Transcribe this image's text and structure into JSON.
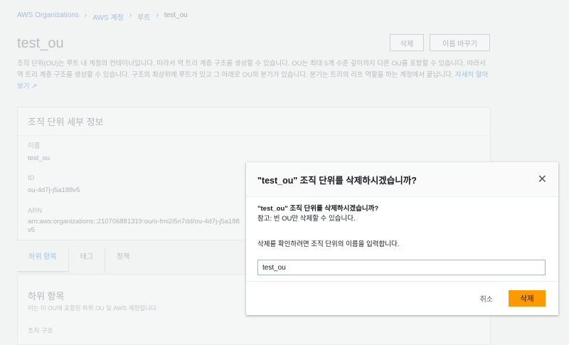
{
  "breadcrumb": [
    "AWS Organizations",
    "AWS 계정",
    "루트",
    "test_ou"
  ],
  "page": {
    "title": "test_ou",
    "delete_label": "삭제",
    "rename_label": "이름 바꾸기",
    "description": "조직 단위(OU)는 루트 내 계정의 컨테이너입니다. 따라서 역 트리 계층 구조를 생성할 수 있습니다. OU는 최대 5개 수준 깊이까지 다른 OU를 포함할 수 있습니다. 따라서 역 트리 계층 구조를 생성할 수 있습니다. 구조의 최상위에 루트가 있고 그 아래로 OU의 분기가 있습니다. 분기는 트리의 리프 역할을 하는 계정에서 끝납니다.",
    "learn_more": "자세히 알아보기"
  },
  "details": {
    "title": "조직 단위 세부 정보",
    "name_label": "이름",
    "name": "test_ou",
    "id_label": "ID",
    "id": "ou-4d7j-j5a188v5",
    "arn_label": "ARN",
    "arn": "arn:aws:organizations::210706881319:ou/o-fmi2i5n7dd/ou-4d7j-j5a188v5"
  },
  "tabs": [
    "하위 항목",
    "태그",
    "정책"
  ],
  "children": {
    "title": "하위 항목",
    "subtitle": "이는 이 OU에 포함된 하위 OU 및 AWS 계정입니다.",
    "structure_label": "조직 구조"
  },
  "modal": {
    "title": "\"test_ou\" 조직 단위를 삭제하시겠습니까?",
    "question": "\"test_ou\" 조직 단위를 삭제하시겠습니까?",
    "note": "참고: 빈 OU만 삭제할 수 있습니다.",
    "confirm_label": "삭제를 확인하려면 조직 단위의 이름을 입력합니다.",
    "input_value": "test_ou",
    "cancel_label": "취소",
    "delete_label": "삭제"
  },
  "colors": {
    "accent": "#ff9900",
    "link": "#0073bb"
  }
}
